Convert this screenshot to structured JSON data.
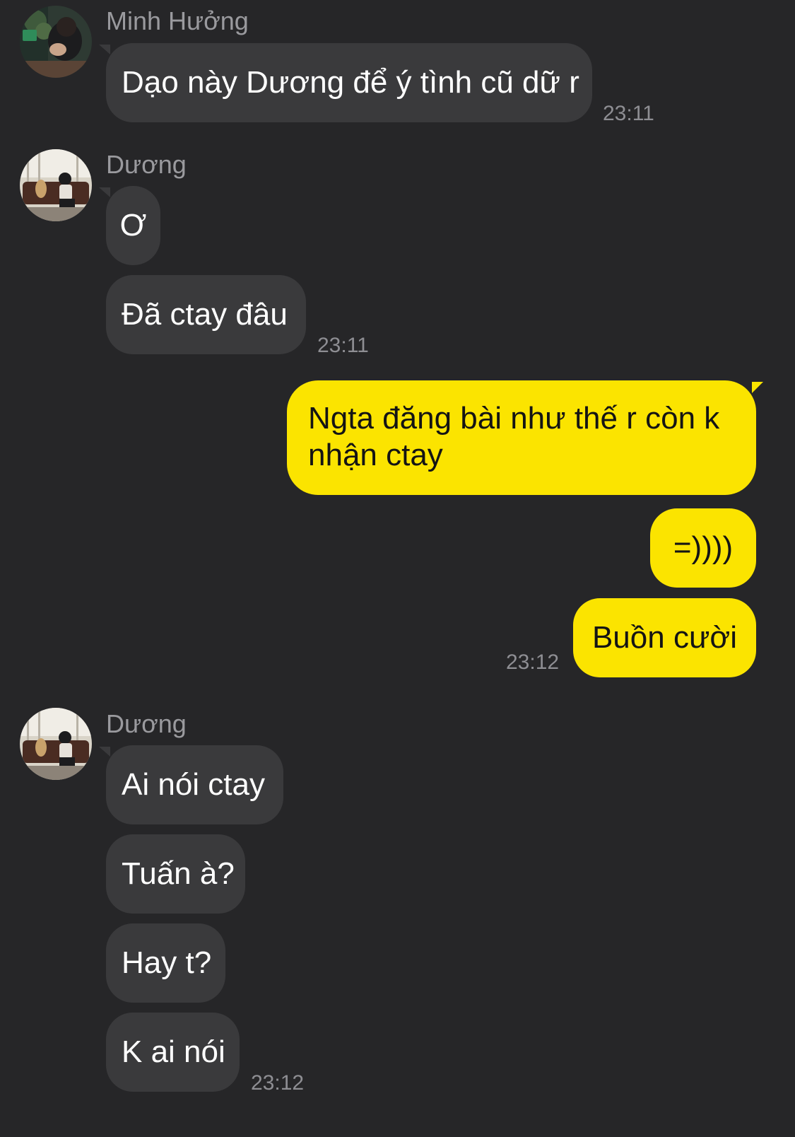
{
  "messages": [
    {
      "sender_name": "Minh Hưởng",
      "avatar_icon": "profile-photo-icon",
      "bubbles": [
        "Dạo này Dương để ý tình cũ dữ r"
      ],
      "time": "23:11"
    },
    {
      "sender_name": "Dương",
      "avatar_icon": "profile-photo-icon",
      "bubbles": [
        "Ơ",
        "Đã ctay đâu"
      ],
      "time": "23:11"
    },
    {
      "outgoing": true,
      "bubbles": [
        "Ngta đăng bài như thế r còn k nhận ctay",
        "=))))",
        "Buồn cười"
      ],
      "time": "23:12"
    },
    {
      "sender_name": "Dương",
      "avatar_icon": "profile-photo-icon",
      "bubbles": [
        "Ai nói ctay",
        "Tuấn à?",
        "Hay t?",
        "K ai nói"
      ],
      "time": "23:12"
    }
  ],
  "colors": {
    "background": "#262628",
    "incoming_bubble": "#3a3a3c",
    "outgoing_bubble": "#fbe400",
    "sender_name": "#9a9a9e",
    "timestamp": "#8e8e93"
  }
}
